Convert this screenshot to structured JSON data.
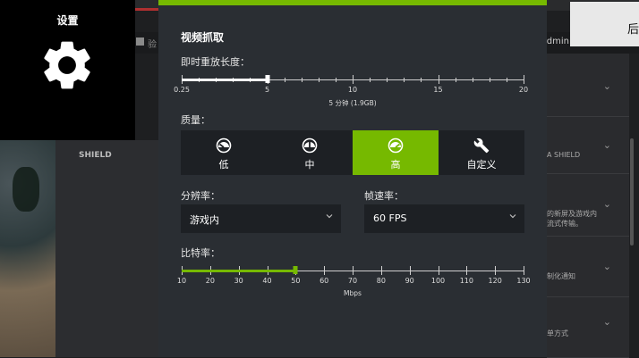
{
  "background": {
    "toolbar_text": "验",
    "toolbar_right": "oldmin",
    "panel_label": "SHIELD",
    "corner_text": "后",
    "right_rows": [
      "",
      "A SHIELD",
      "的新屏及游戏内\n流式传输。",
      "制化通知",
      "单方式"
    ]
  },
  "settings": {
    "title": "设置",
    "icon": "gear-icon"
  },
  "modal": {
    "title": "视频抓取",
    "accent_color": "#76b900",
    "instant_replay": {
      "label": "即时重放长度：",
      "ticks": [
        "0.25",
        "5",
        "10",
        "15",
        "20"
      ],
      "value_minutes": 5,
      "caption": "5 分钟 (1.9GB)"
    },
    "quality": {
      "label": "质量：",
      "options": [
        {
          "label": "低",
          "icon": "gauge-low-icon"
        },
        {
          "label": "中",
          "icon": "gauge-medium-icon"
        },
        {
          "label": "高",
          "icon": "gauge-high-icon"
        },
        {
          "label": "自定义",
          "icon": "wrench-icon"
        }
      ],
      "selected": "高"
    },
    "resolution": {
      "label": "分辨率：",
      "value": "游戏内"
    },
    "framerate": {
      "label": "帧速率：",
      "value": "60 FPS"
    },
    "bitrate": {
      "label": "比特率：",
      "ticks": [
        "10",
        "20",
        "30",
        "40",
        "50",
        "60",
        "70",
        "80",
        "90",
        "100",
        "110",
        "120",
        "130"
      ],
      "value": 50,
      "unit": "Mbps"
    }
  }
}
